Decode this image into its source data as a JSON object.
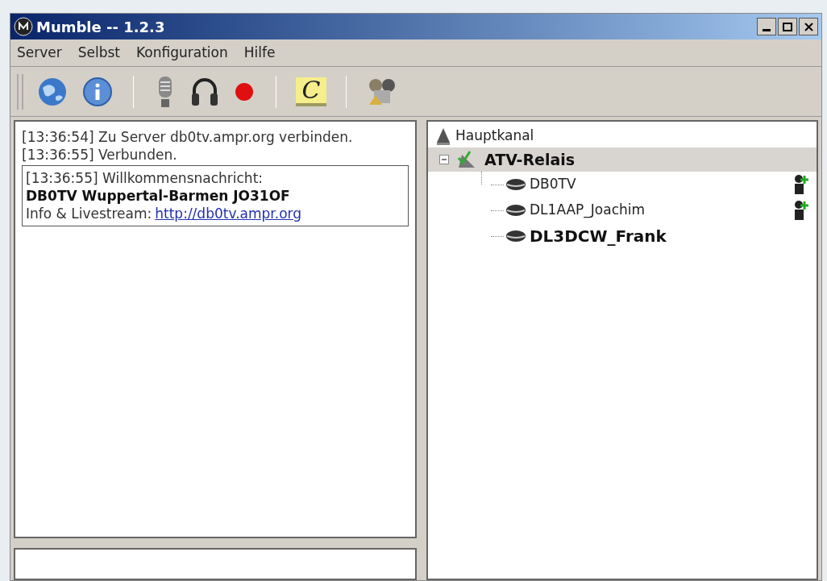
{
  "window": {
    "title": "Mumble -- 1.2.3"
  },
  "menu": [
    "Server",
    "Selbst",
    "Konfiguration",
    "Hilfe"
  ],
  "toolbar": [
    {
      "kind": "globe"
    },
    {
      "kind": "info"
    },
    {
      "kind": "sep"
    },
    {
      "kind": "mic"
    },
    {
      "kind": "headphones"
    },
    {
      "kind": "record"
    },
    {
      "kind": "sep"
    },
    {
      "kind": "comment",
      "label": "C"
    },
    {
      "kind": "sep"
    },
    {
      "kind": "users"
    }
  ],
  "log": [
    {
      "time": "[13:36:54]",
      "text": "Zu Server db0tv.ampr.org verbinden."
    },
    {
      "time": "[13:36:55]",
      "text": "Verbunden."
    }
  ],
  "welcome": {
    "time": "[13:36:55]",
    "text": "Willkommensnachricht:",
    "headline": "DB0TV Wuppertal-Barmen JO31OF",
    "info": "Info & Livestream:",
    "link": "http://db0tv.ampr.org"
  },
  "tree": {
    "name": "Hauptkanal",
    "children": [
      {
        "name": "ATV-Relais",
        "selected": true,
        "expanded": true,
        "users": [
          {
            "name": "DB0TV",
            "self": false,
            "registered": true
          },
          {
            "name": "DL1AAP_Joachim",
            "self": false,
            "registered": true
          },
          {
            "name": "DL3DCW_Frank",
            "self": true,
            "registered": false
          }
        ]
      }
    ]
  }
}
